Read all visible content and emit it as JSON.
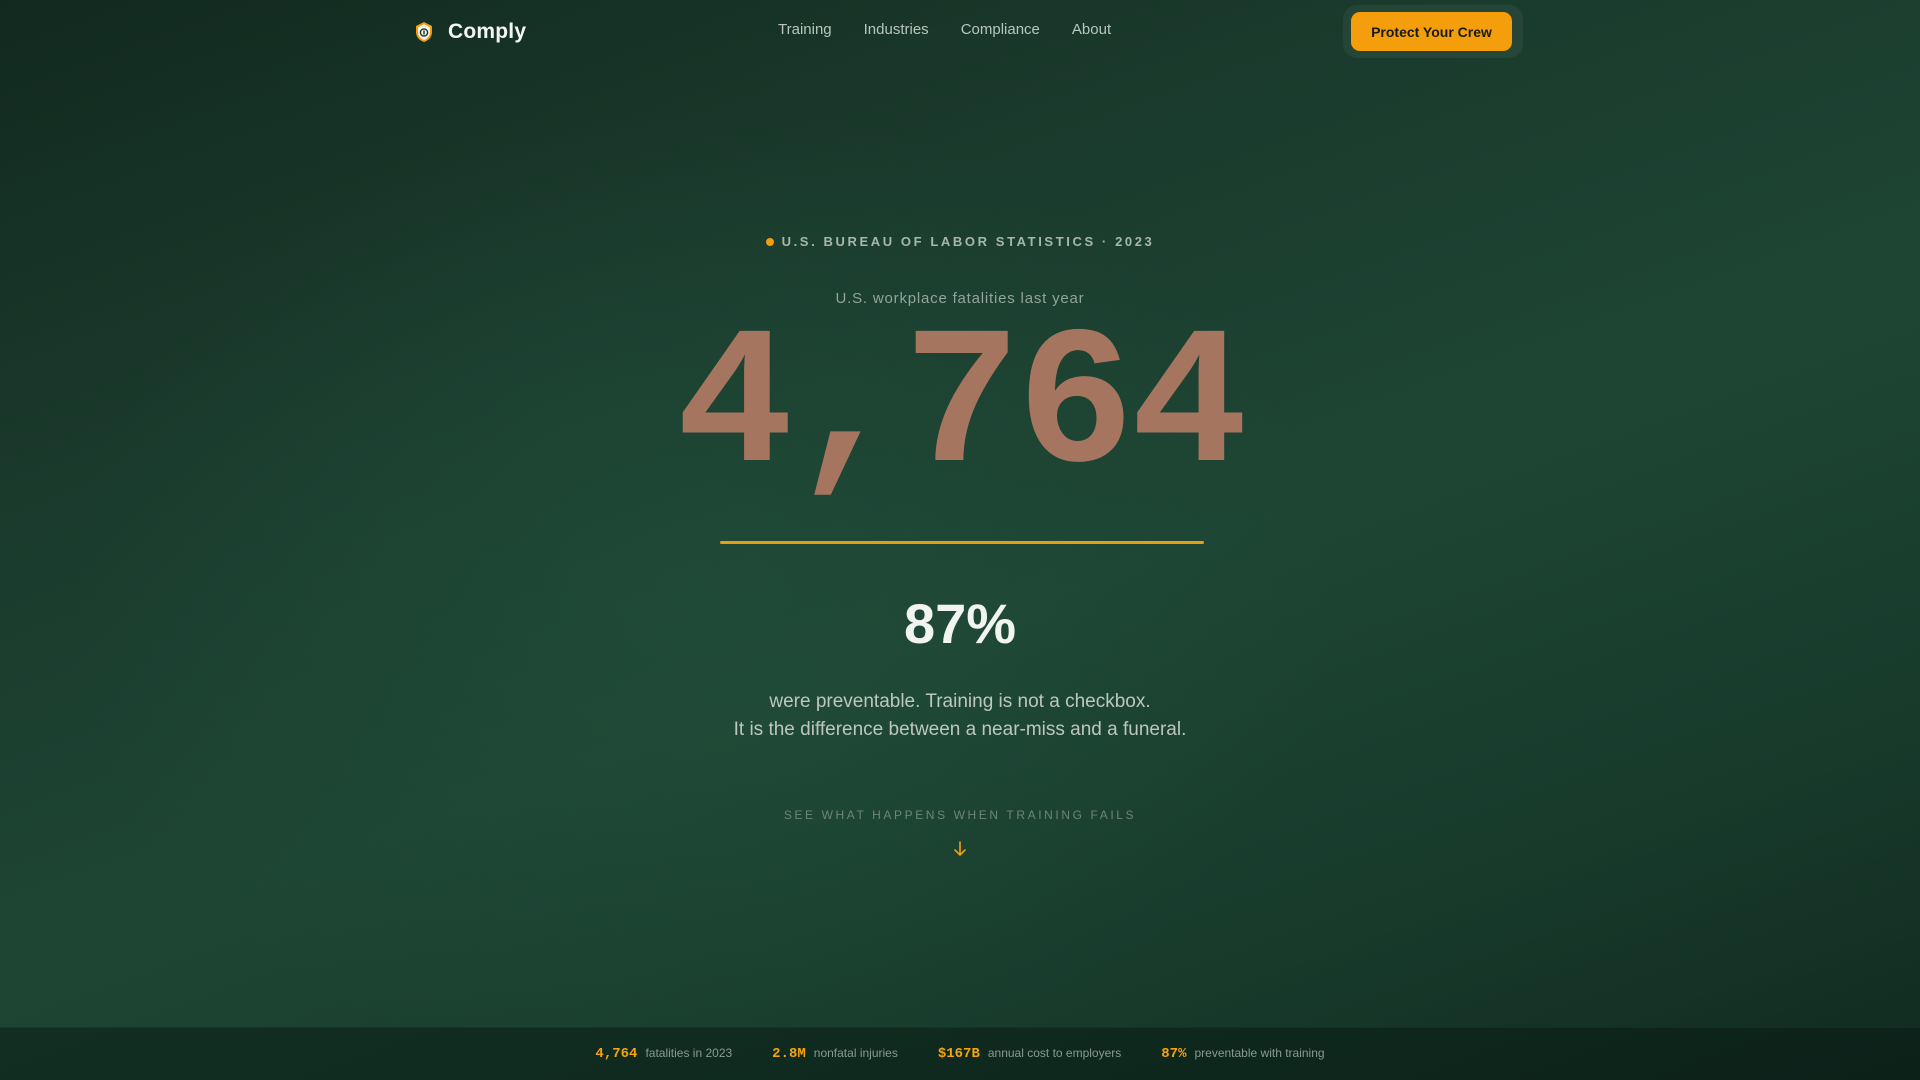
{
  "nav": {
    "brand": "Comply",
    "links": [
      "Training",
      "Industries",
      "Compliance",
      "About"
    ],
    "cta": "Protect Your Crew"
  },
  "hero": {
    "eyebrow": "U.S. BUREAU OF LABOR STATISTICS · 2023",
    "kicker": "U.S. workplace fatalities last year",
    "big_number": "4,764",
    "percent": "87%",
    "line1": "were preventable. Training is not a checkbox.",
    "line2": "It is the difference between a near-miss and a funeral.",
    "scroll_label": "SEE WHAT HAPPENS WHEN TRAINING FAILS"
  },
  "stats": [
    {
      "value": "4,764",
      "label": "fatalities in 2023"
    },
    {
      "value": "2.8M",
      "label": "nonfatal injuries"
    },
    {
      "value": "$167B",
      "label": "annual cost to employers"
    },
    {
      "value": "87%",
      "label": "preventable with training"
    }
  ],
  "colors": {
    "accent": "#f59e0b",
    "big_number": "#a67560",
    "background": "#1e4534"
  },
  "icons": {
    "brand": "shield-icon",
    "scroll": "arrow-down-icon"
  }
}
